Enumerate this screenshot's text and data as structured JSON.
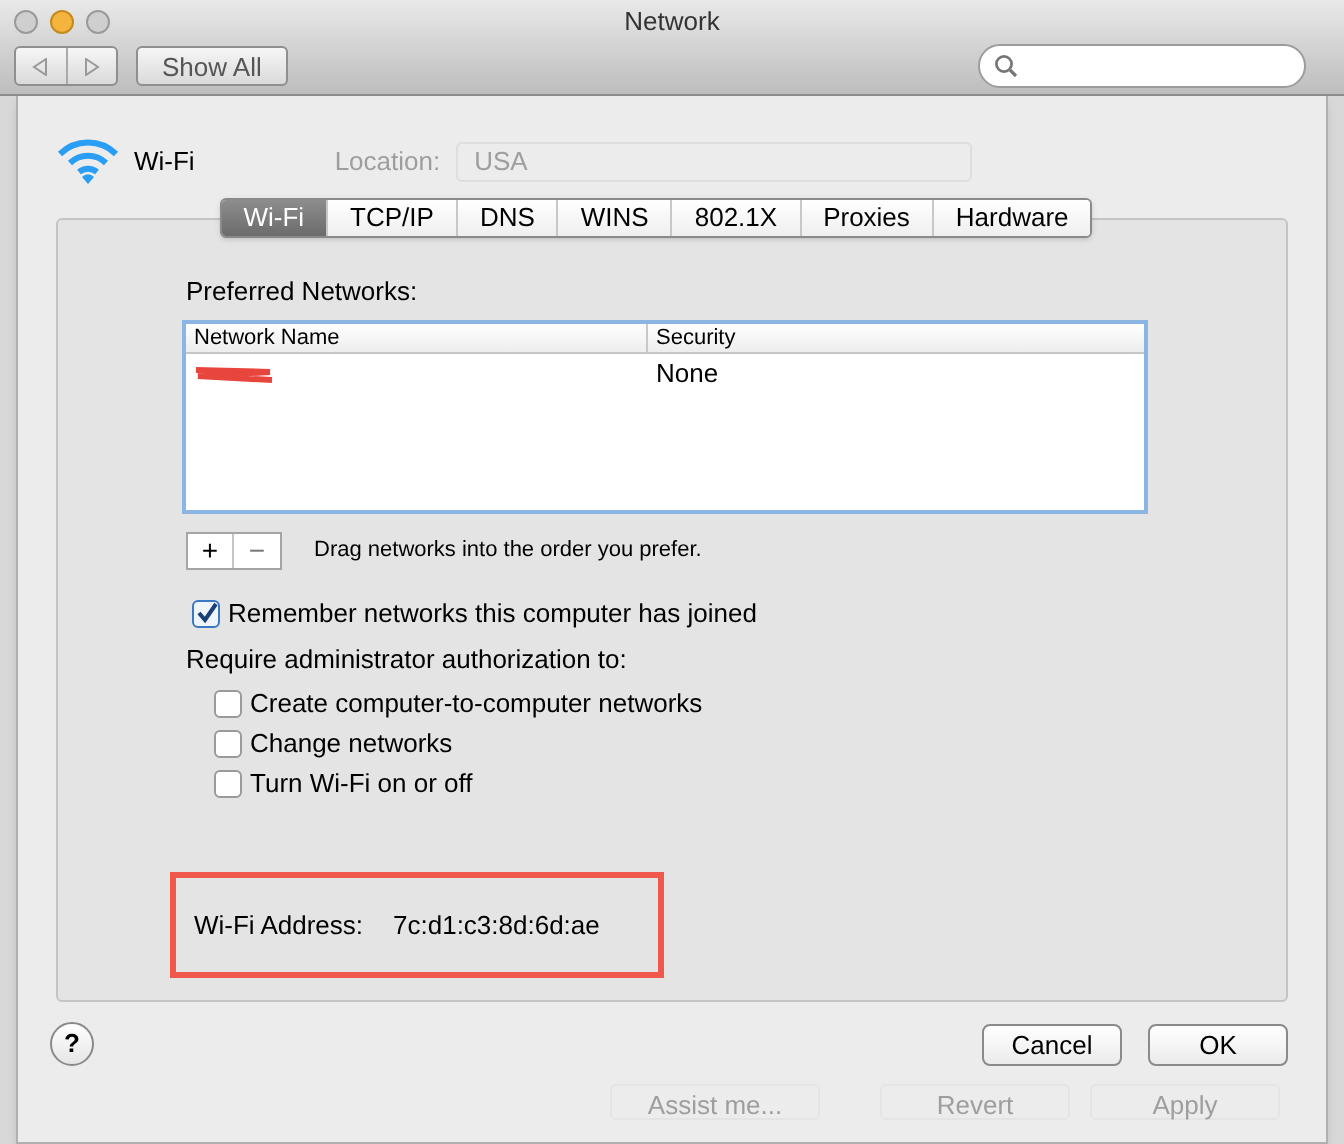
{
  "window": {
    "title": "Network",
    "show_all": "Show All"
  },
  "service": {
    "name": "Wi-Fi",
    "location_label": "Location:",
    "location_value": "USA"
  },
  "tabs": [
    {
      "label": "Wi-Fi",
      "selected": true
    },
    {
      "label": "TCP/IP",
      "selected": false
    },
    {
      "label": "DNS",
      "selected": false
    },
    {
      "label": "WINS",
      "selected": false
    },
    {
      "label": "802.1X",
      "selected": false
    },
    {
      "label": "Proxies",
      "selected": false
    },
    {
      "label": "Hardware",
      "selected": false
    }
  ],
  "preferred_networks": {
    "label": "Preferred Networks:",
    "columns": [
      "Network Name",
      "Security"
    ],
    "rows": [
      {
        "name_redacted": true,
        "security": "None"
      }
    ],
    "hint": "Drag networks into the order you prefer.",
    "add": "+",
    "remove": "−"
  },
  "remember": {
    "label": "Remember networks this computer has joined",
    "checked": true
  },
  "require_label": "Require administrator authorization to:",
  "require_options": [
    {
      "label": "Create computer-to-computer networks",
      "checked": false
    },
    {
      "label": "Change networks",
      "checked": false
    },
    {
      "label": "Turn Wi-Fi on or off",
      "checked": false
    }
  ],
  "address": {
    "label": "Wi-Fi Address:",
    "value": "7c:d1:c3:8d:6d:ae",
    "highlighted": true
  },
  "buttons": [
    {
      "label": "Cancel"
    },
    {
      "label": "OK"
    }
  ],
  "help": "?",
  "background_buttons": [
    {
      "label": "Assist me..."
    },
    {
      "label": "Revert"
    },
    {
      "label": "Apply"
    }
  ]
}
